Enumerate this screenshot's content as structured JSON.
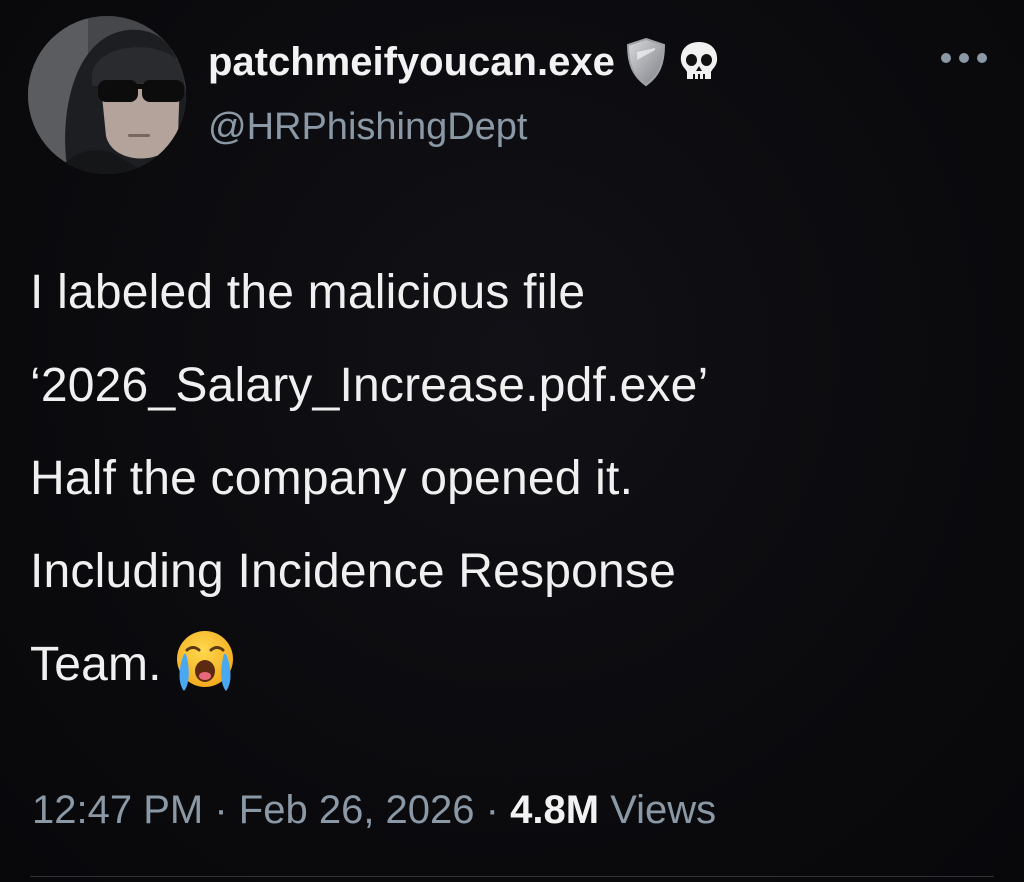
{
  "author": {
    "display_name": "patchmeifyoucan.exe",
    "handle": "@HRPhishingDept",
    "badges": [
      "shield-icon",
      "skull-icon"
    ]
  },
  "tweet": {
    "lines": [
      "I labeled the malicious file",
      "‘2026_Salary_Increase.pdf.exe’",
      "Half the company opened it.",
      "Including Incidence Response",
      "Team."
    ],
    "trailing_emoji": "loudly-crying-face-emoji"
  },
  "meta": {
    "time": "12:47 PM",
    "separator": "·",
    "date": "Feb 26, 2026",
    "views_count": "4.8M",
    "views_label": "Views"
  },
  "more_menu_icon": "more-options-icon"
}
